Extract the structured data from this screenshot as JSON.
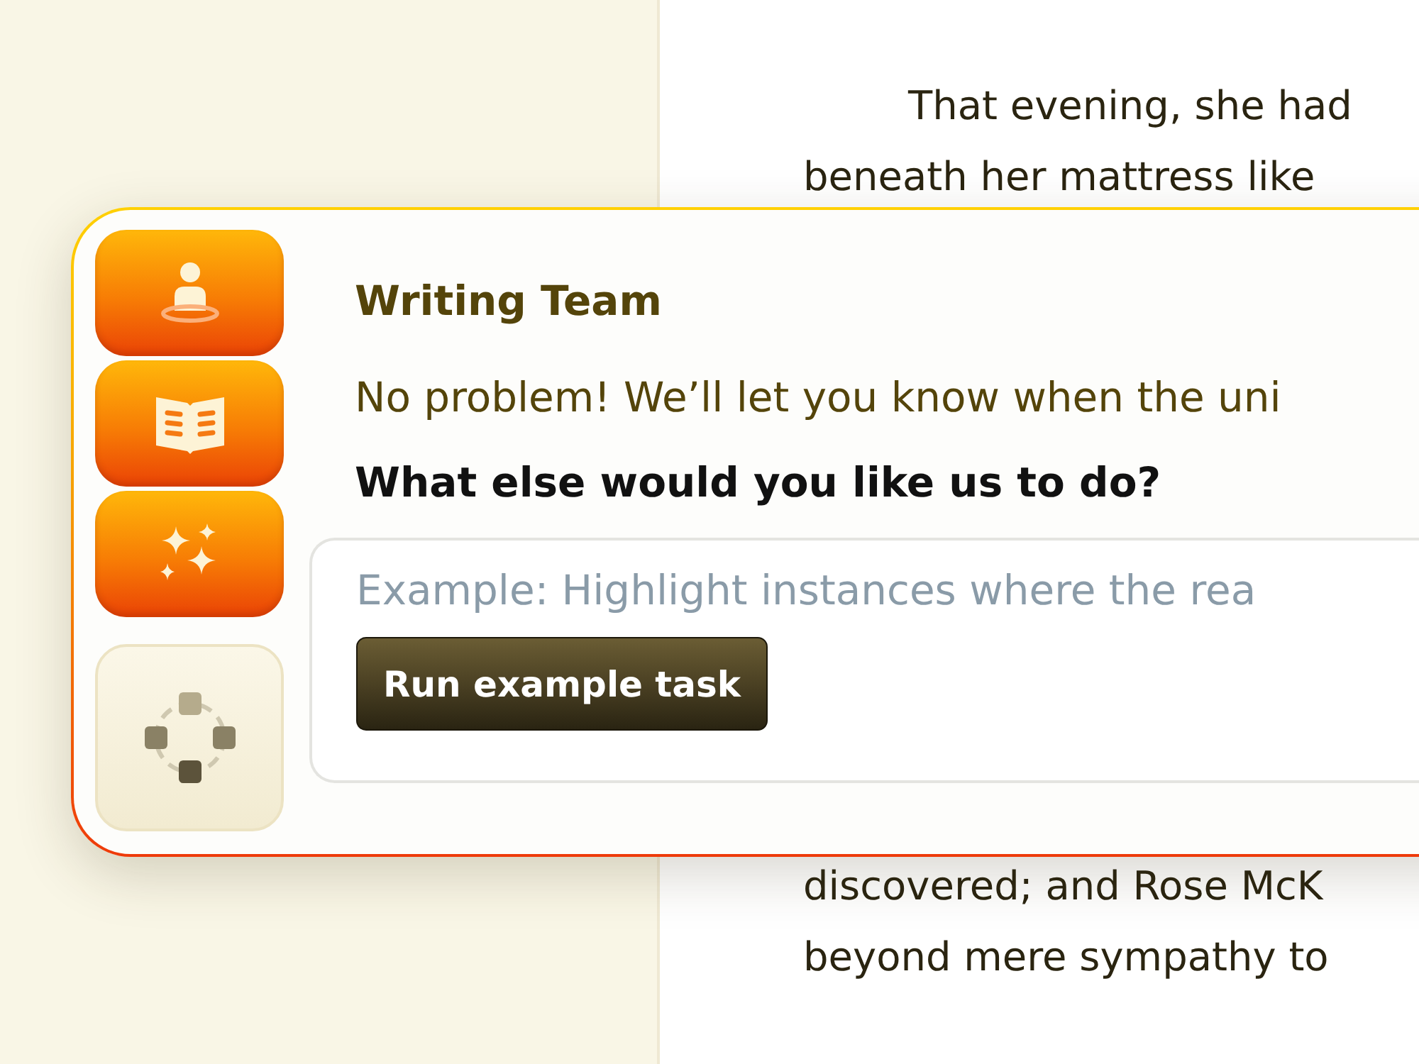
{
  "document": {
    "lines_top": [
      {
        "text": "That evening, she had",
        "indent": true
      },
      {
        "text": "beneath her mattress like",
        "indent": false
      }
    ],
    "lines_bottom": [
      {
        "text": "discovered; and Rose McK",
        "indent": false
      },
      {
        "text": "beyond mere sympathy to",
        "indent": false
      }
    ]
  },
  "panel": {
    "tools": [
      {
        "kind": "person",
        "active": true
      },
      {
        "kind": "book",
        "active": true
      },
      {
        "kind": "sparkles",
        "active": true
      },
      {
        "kind": "nodes",
        "active": false
      }
    ],
    "title": "Writing Team",
    "message": "No problem! We’ll let you know when the uni",
    "question": "What else would you like us to do?",
    "task_field": {
      "placeholder": "Example: Highlight instances where the rea"
    },
    "button": "Run example task"
  }
}
